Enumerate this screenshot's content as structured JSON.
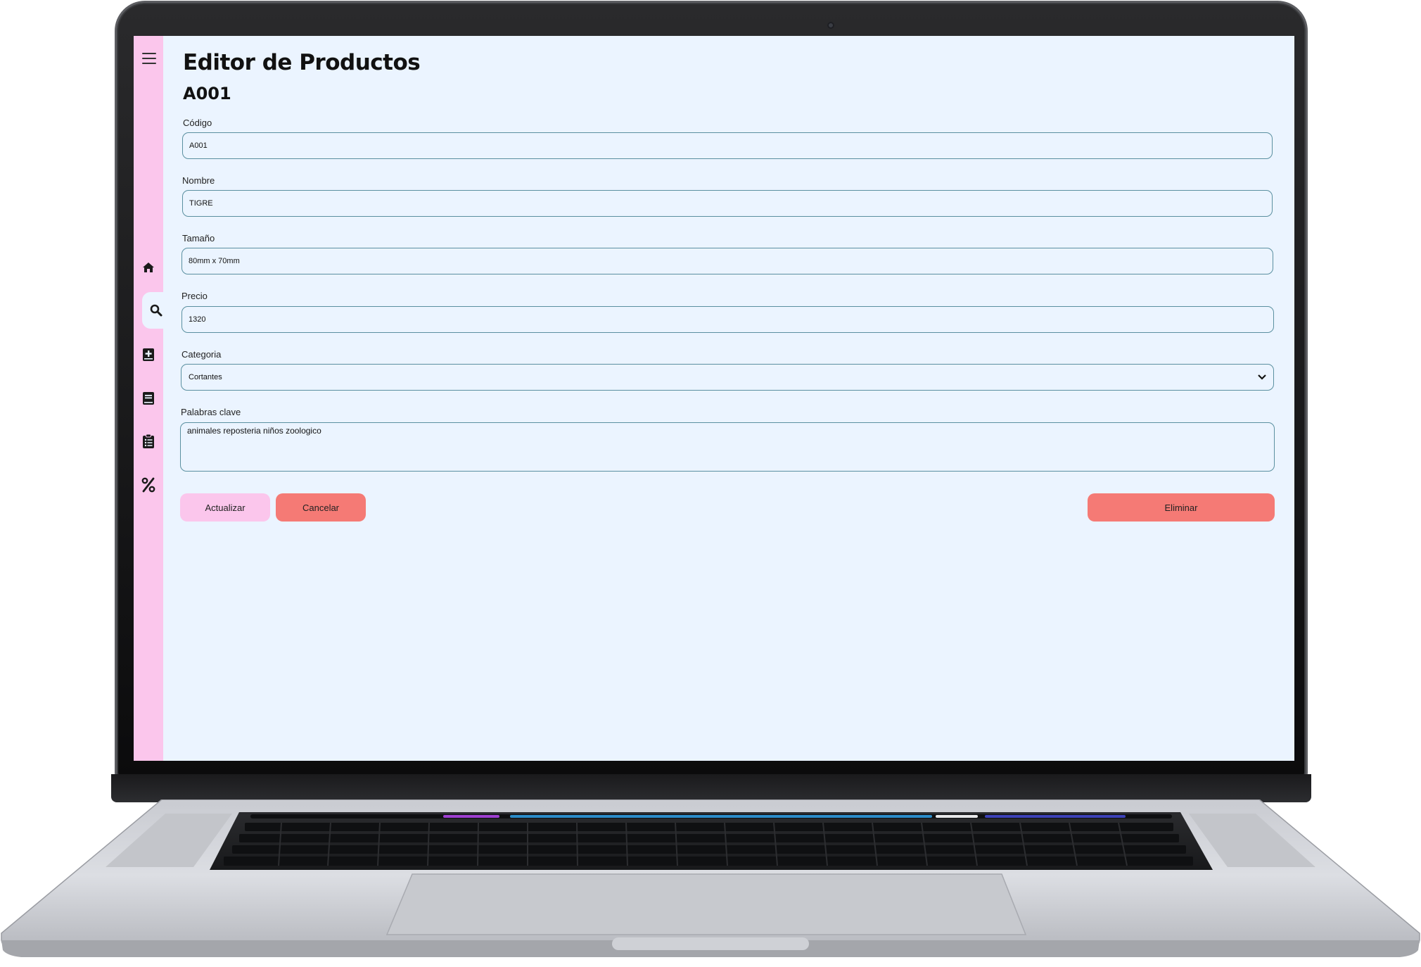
{
  "app": {
    "title": "Editor de Productos",
    "product_code_heading": "A001"
  },
  "sidebar": {
    "items": [
      {
        "icon": "home-icon",
        "active": false
      },
      {
        "icon": "search-icon",
        "active": true
      },
      {
        "icon": "add-book-icon",
        "active": false
      },
      {
        "icon": "book-icon",
        "active": false
      },
      {
        "icon": "clipboard-list-icon",
        "active": false
      },
      {
        "icon": "percent-icon",
        "active": false
      }
    ]
  },
  "form": {
    "codigo": {
      "label": "Código",
      "value": "A001"
    },
    "nombre": {
      "label": "Nombre",
      "value": "TIGRE"
    },
    "tamano": {
      "label": "Tamaño",
      "value": "80mm x 70mm"
    },
    "precio": {
      "label": "Precio",
      "value": "1320"
    },
    "categoria": {
      "label": "Categoria",
      "value": "Cortantes"
    },
    "palabras_clave": {
      "label": "Palabras clave",
      "value": "animales reposteria niños zoologico"
    }
  },
  "buttons": {
    "actualizar": "Actualizar",
    "cancelar": "Cancelar",
    "eliminar": "Eliminar"
  },
  "colors": {
    "sidebar": "#fbc6ec",
    "background": "#ebf4ff",
    "primary_button": "#fbc6ec",
    "danger_button": "#f57a75",
    "input_border": "#5a8fa0"
  }
}
